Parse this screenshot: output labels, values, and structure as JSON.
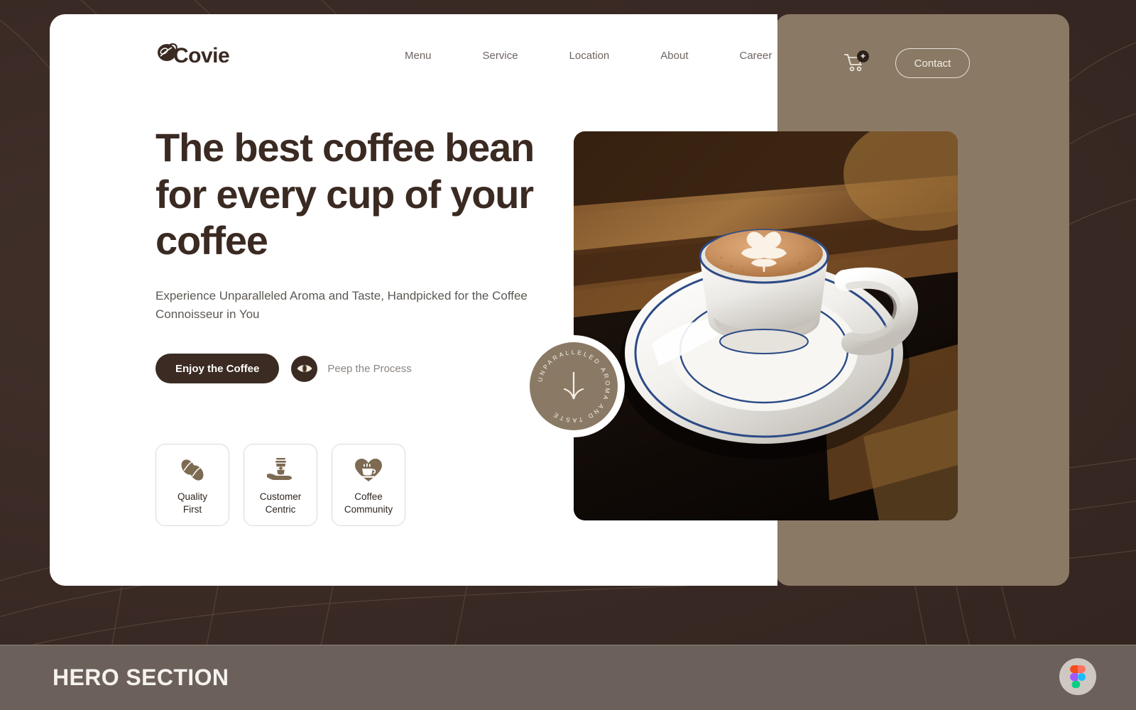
{
  "brand": {
    "name": "Covie",
    "logo_icon": "coffee-bean-logo-icon"
  },
  "nav": {
    "items": [
      {
        "label": "Menu"
      },
      {
        "label": "Service"
      },
      {
        "label": "Location"
      },
      {
        "label": "About"
      },
      {
        "label": "Career"
      }
    ],
    "cart": {
      "icon": "shopping-cart-icon",
      "badge": "+"
    },
    "contact_label": "Contact"
  },
  "hero": {
    "headline": "The best coffee bean for every cup of your coffee",
    "subtitle": "Experience Unparalleled Aroma and Taste, Handpicked for the Coffee Connoisseur in You",
    "primary_cta": "Enjoy the Coffee",
    "secondary_cta": "Peep the Process",
    "secondary_icon": "eye-icon",
    "image_alt": "latte-art-coffee-cup-photo"
  },
  "scroll_badge": {
    "ring_text": "UNPARALLELED AROMA AND TASTE ",
    "icon": "arrow-down-icon"
  },
  "features": [
    {
      "label": "Quality\nFirst",
      "icon": "coffee-beans-icon"
    },
    {
      "label": "Customer\nCentric",
      "icon": "hand-holding-cup-icon"
    },
    {
      "label": "Coffee\nCommunity",
      "icon": "heart-cup-icon"
    }
  ],
  "caption": {
    "title": "HERO SECTION",
    "badge_icon": "figma-logo-icon"
  },
  "colors": {
    "backdrop": "#382823",
    "tan_panel": "#8a7964",
    "card": "#ffffff",
    "text_dark": "#3a2a22",
    "text_muted": "#6d6561",
    "caption_bar": "#6c615a"
  }
}
